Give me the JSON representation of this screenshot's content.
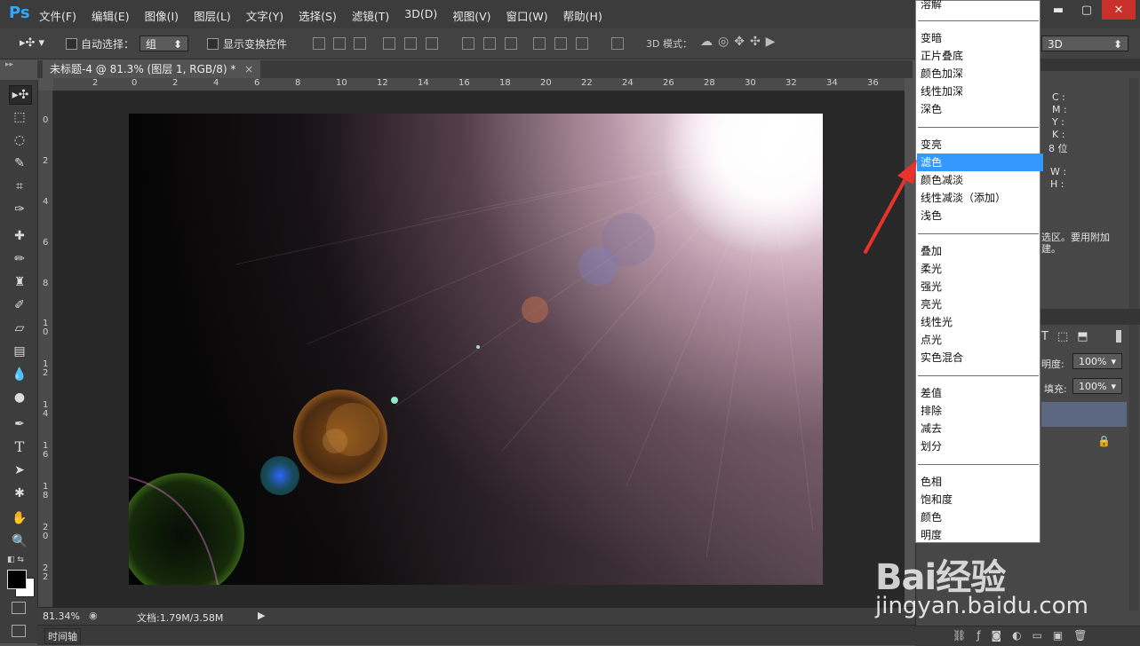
{
  "app": {
    "logo": "Ps",
    "menu": [
      "文件(F)",
      "编辑(E)",
      "图像(I)",
      "图层(L)",
      "文字(Y)",
      "选择(S)",
      "滤镜(T)",
      "3D(D)",
      "视图(V)",
      "窗口(W)",
      "帮助(H)"
    ],
    "window_controls": {
      "minimize": "▬",
      "maximize": "▢",
      "close": "✕"
    }
  },
  "options": {
    "auto_select_label": "自动选择：",
    "auto_select_value": "组",
    "show_transform_label": "显示变换控件",
    "mode3d_label": "3D 模式：",
    "workspace_value": "3D"
  },
  "document": {
    "tab_title": "未标题-4 @ 81.3% (图层 1, RGB/8) *",
    "tab_close": "×"
  },
  "ruler": {
    "top_ticks": [
      "2",
      "0",
      "2",
      "4",
      "6",
      "8",
      "10",
      "12",
      "14",
      "16",
      "18",
      "20",
      "22",
      "24",
      "26",
      "28",
      "30",
      "32",
      "34",
      "36"
    ],
    "left_ticks": [
      "0",
      "2",
      "4",
      "6",
      "8",
      "1\n0",
      "1\n2",
      "1\n4",
      "1\n6",
      "1\n8",
      "2\n0",
      "2\n2"
    ]
  },
  "status": {
    "zoom": "81.34%",
    "doc_info": "文档:1.79M/3.58M",
    "timeline_label": "时间轴"
  },
  "info_panel": {
    "cmyk": [
      "C :",
      "M :",
      "Y :",
      "K :"
    ],
    "bit_depth": "8 位",
    "size": [
      "W :",
      "H :"
    ],
    "hint_line1": "选区。要用附加",
    "hint_line2": "建。"
  },
  "layers_panel": {
    "opacity_label": "明度:",
    "opacity_value": "100%",
    "fill_label": "填充:",
    "fill_value": "100%"
  },
  "blend_modes": {
    "top_partial": "溶解",
    "group_darken": [
      "变暗",
      "正片叠底",
      "颜色加深",
      "线性加深",
      "深色"
    ],
    "group_lighten": [
      "变亮",
      "滤色",
      "颜色减淡",
      "线性减淡（添加）",
      "浅色"
    ],
    "group_contrast": [
      "叠加",
      "柔光",
      "强光",
      "亮光",
      "线性光",
      "点光",
      "实色混合"
    ],
    "group_compare": [
      "差值",
      "排除",
      "减去",
      "划分"
    ],
    "group_component": [
      "色相",
      "饱和度",
      "颜色",
      "明度"
    ],
    "selected": "滤色"
  },
  "watermark": {
    "logo": "Bai经验",
    "url": "jingyan.baidu.com"
  },
  "colors": {
    "selection": "#3399ff",
    "arrow": "#e8322a",
    "close_button": "#c9302c"
  }
}
